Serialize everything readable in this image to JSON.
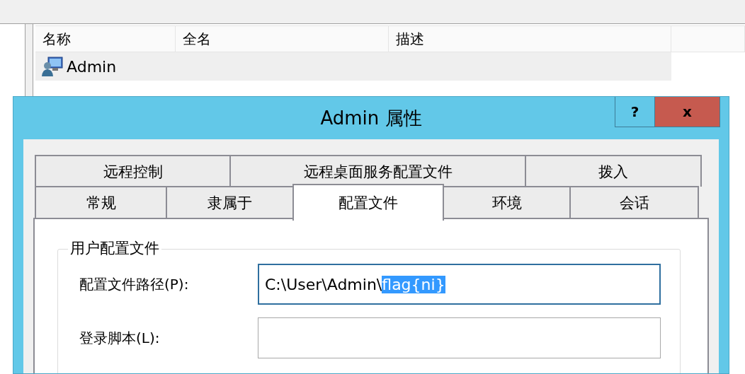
{
  "list": {
    "columns": [
      "名称",
      "全名",
      "描述"
    ],
    "rows": [
      {
        "name": "Admin",
        "selected": true
      }
    ]
  },
  "dialog": {
    "title": "Admin 属性",
    "help_button": "?",
    "close_button": "x",
    "tab_rows": [
      [
        {
          "label": "远程控制",
          "selected": false
        },
        {
          "label": "远程桌面服务配置文件",
          "selected": false
        },
        {
          "label": "拨入",
          "selected": false
        }
      ],
      [
        {
          "label": "常规",
          "selected": false
        },
        {
          "label": "隶属于",
          "selected": false
        },
        {
          "label": "配置文件",
          "selected": true
        },
        {
          "label": "环境",
          "selected": false
        },
        {
          "label": "会话",
          "selected": false
        }
      ]
    ],
    "group": {
      "title": "用户配置文件",
      "fields": [
        {
          "label": "配置文件路径(P):",
          "focused": true,
          "value_parts": [
            {
              "text": "C:\\User\\Admin\\",
              "selected": false
            },
            {
              "text": "flag{ni}",
              "selected": true
            }
          ]
        },
        {
          "label": "登录脚本(L):",
          "focused": false
        }
      ]
    }
  }
}
